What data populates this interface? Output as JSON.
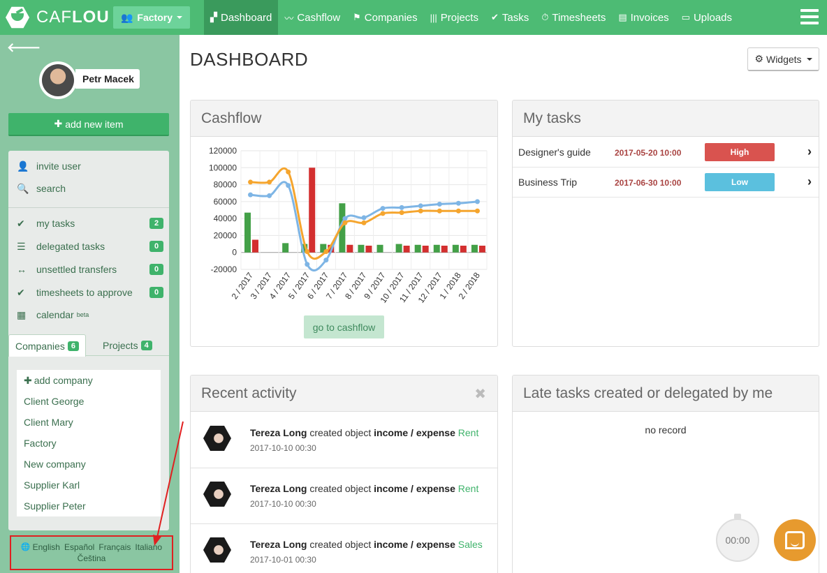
{
  "brand": {
    "name_light": "CAF",
    "name_bold": "LOU"
  },
  "company_select": {
    "label": "Factory"
  },
  "nav": [
    {
      "label": "Dashboard",
      "icon": "dashboard-icon",
      "glyph": "▞"
    },
    {
      "label": "Cashflow",
      "icon": "cashflow-icon",
      "glyph": "〰"
    },
    {
      "label": "Companies",
      "icon": "flag-icon",
      "glyph": "⚑"
    },
    {
      "label": "Projects",
      "icon": "columns-icon",
      "glyph": "|||"
    },
    {
      "label": "Tasks",
      "icon": "check-icon",
      "glyph": "✔"
    },
    {
      "label": "Timesheets",
      "icon": "stopwatch-icon",
      "glyph": "⏱"
    },
    {
      "label": "Invoices",
      "icon": "file-icon",
      "glyph": "▤"
    },
    {
      "label": "Uploads",
      "icon": "upload-icon",
      "glyph": "▭"
    }
  ],
  "user": {
    "name": "Petr Macek"
  },
  "sidebar": {
    "add_label": "add new item",
    "items": [
      {
        "label": "invite user",
        "icon": "user-plus-icon",
        "glyph": "👤"
      },
      {
        "label": "search",
        "icon": "search-icon",
        "glyph": "🔍"
      },
      {
        "label": "my tasks",
        "icon": "tasks-icon",
        "glyph": "✔",
        "count": "2"
      },
      {
        "label": "delegated tasks",
        "icon": "delegated-icon",
        "glyph": "☰",
        "count": "0"
      },
      {
        "label": "unsettled transfers",
        "icon": "transfer-icon",
        "glyph": "↔",
        "count": "0"
      },
      {
        "label": "timesheets to approve",
        "icon": "timesheet-approve-icon",
        "glyph": "✔",
        "count": "0"
      },
      {
        "label": "calendar",
        "icon": "calendar-icon",
        "glyph": "▦",
        "badge": "beta"
      }
    ],
    "tabs": [
      {
        "label": "Companies",
        "count": "6"
      },
      {
        "label": "Projects",
        "count": "4"
      }
    ],
    "add_company": "add company",
    "companies": [
      "Client George",
      "Client Mary",
      "Factory",
      "New company",
      "Supplier Karl",
      "Supplier Peter"
    ],
    "languages": [
      "English",
      "Español",
      "Français",
      "Italiano",
      "Čeština"
    ]
  },
  "page": {
    "title": "DASHBOARD",
    "widgets_label": "Widgets"
  },
  "cashflow": {
    "title": "Cashflow",
    "button": "go to cashflow"
  },
  "tasks": {
    "title": "My tasks",
    "rows": [
      {
        "name": "Designer's guide",
        "date": "2017-05-20 10:00",
        "priority": "High",
        "color": "#d9534f"
      },
      {
        "name": "Business Trip",
        "date": "2017-06-30 10:00",
        "priority": "Low",
        "color": "#5bc0de"
      }
    ]
  },
  "activity": {
    "title": "Recent activity",
    "rows": [
      {
        "user": "Tereza Long",
        "action": "created object",
        "object": "income / expense",
        "link": "Rent",
        "time": "2017-10-10 00:30"
      },
      {
        "user": "Tereza Long",
        "action": "created object",
        "object": "income / expense",
        "link": "Rent",
        "time": "2017-10-10 00:30"
      },
      {
        "user": "Tereza Long",
        "action": "created object",
        "object": "income / expense",
        "link": "Sales",
        "time": "2017-10-01 00:30"
      }
    ]
  },
  "late_tasks": {
    "title": "Late tasks created or delegated by me",
    "empty": "no record"
  },
  "timer": {
    "value": "00:00"
  },
  "colors": {
    "brand": "#4dbb74",
    "income": "#43a047",
    "expense": "#d32f2f",
    "line_blue": "#7eb5e5",
    "line_orange": "#f5a52e"
  },
  "chart_data": {
    "type": "bar",
    "categories": [
      "2 / 2017",
      "3 / 2017",
      "4 / 2017",
      "5 / 2017",
      "6 / 2017",
      "7 / 2017",
      "8 / 2017",
      "9 / 2017",
      "10 / 2017",
      "11 / 2017",
      "12 / 2017",
      "1 / 2018",
      "2 / 2018"
    ],
    "ylim": [
      -20000,
      120000
    ],
    "yticks": [
      -20000,
      0,
      20000,
      40000,
      60000,
      80000,
      100000,
      120000
    ],
    "grid": true,
    "series": [
      {
        "type": "bar",
        "values": [
          47000,
          0,
          11000,
          10000,
          10000,
          58000,
          9000,
          9000,
          10000,
          9000,
          9000,
          9000,
          9000
        ]
      },
      {
        "type": "bar",
        "values": [
          15000,
          0,
          0,
          100000,
          9000,
          9000,
          8000,
          0,
          8000,
          8000,
          8000,
          8000,
          8000
        ]
      },
      {
        "type": "line",
        "values": [
          68000,
          67000,
          79000,
          -14000,
          -9000,
          40000,
          41000,
          52000,
          53000,
          55000,
          57000,
          58000,
          60000
        ]
      },
      {
        "type": "line",
        "values": [
          83000,
          83000,
          95000,
          1000,
          1000,
          35000,
          35000,
          46000,
          47000,
          49000,
          49000,
          49000,
          49000
        ]
      }
    ]
  }
}
